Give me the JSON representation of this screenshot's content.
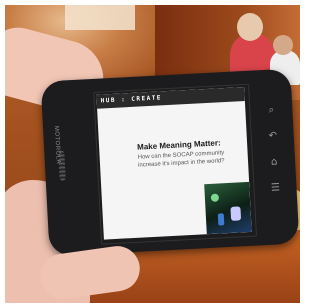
{
  "phone": {
    "brand": "MOTOROLA",
    "screen": {
      "header": "HUB : CREATE",
      "slide_title": "Make Meaning Matter:",
      "slide_subtitle": "How can the SOCAP community increase it's impact in the world?"
    },
    "softkeys": [
      {
        "icon": "search-icon",
        "glyph": "⌕"
      },
      {
        "icon": "back-icon",
        "glyph": "↶"
      },
      {
        "icon": "home-icon",
        "glyph": "⌂"
      },
      {
        "icon": "menu-icon",
        "glyph": "☰"
      }
    ]
  }
}
